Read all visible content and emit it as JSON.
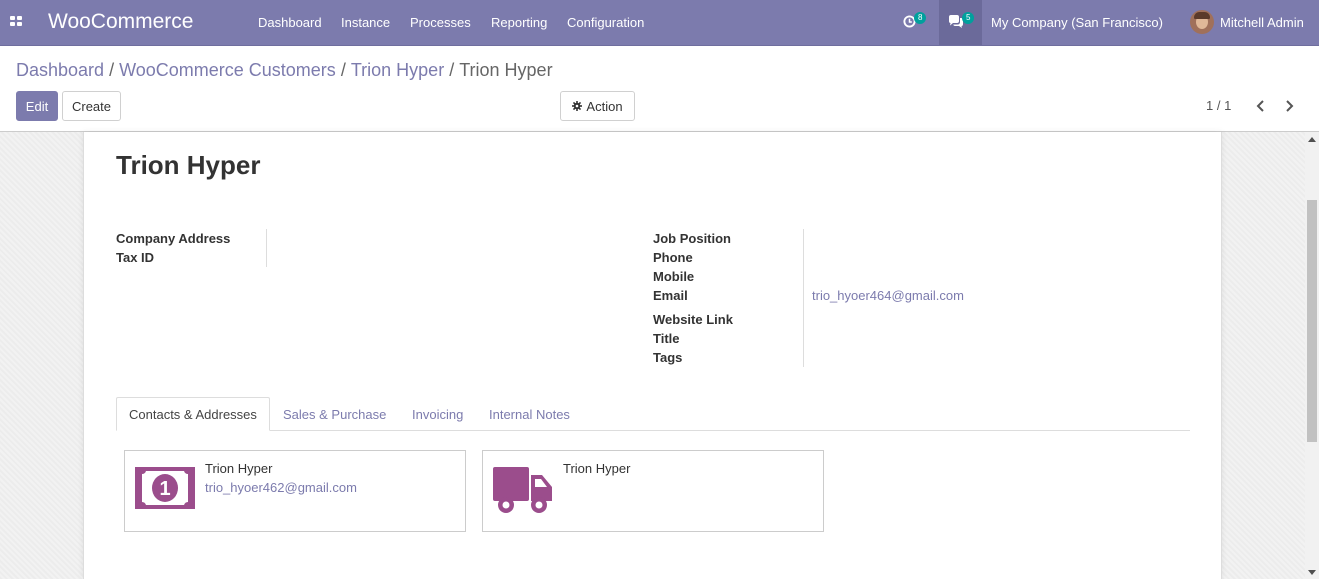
{
  "navbar": {
    "brand": "WooCommerce",
    "menu": [
      "Dashboard",
      "Instance",
      "Processes",
      "Reporting",
      "Configuration"
    ],
    "activity_count": "8",
    "messages_count": "5",
    "company": "My Company (San Francisco)",
    "user": "Mitchell Admin"
  },
  "breadcrumb": {
    "items": [
      "Dashboard",
      "WooCommerce Customers",
      "Trion Hyper"
    ],
    "current": "Trion Hyper",
    "separator": "/"
  },
  "actions": {
    "edit_label": "Edit",
    "create_label": "Create",
    "action_label": "Action"
  },
  "pager": {
    "value": "1 / 1"
  },
  "record": {
    "name": "Trion Hyper",
    "left_fields": [
      "Company Address",
      "Tax ID"
    ],
    "right_fields": {
      "job_position": "Job Position",
      "phone": "Phone",
      "mobile": "Mobile",
      "email_label": "Email",
      "email_value": "trio_hyoer464@gmail.com",
      "website": "Website Link",
      "title": "Title",
      "tags": "Tags"
    }
  },
  "tabs": [
    "Contacts & Addresses",
    "Sales & Purchase",
    "Invoicing",
    "Internal Notes"
  ],
  "cards": [
    {
      "name": "Trion Hyper",
      "email": "trio_hyoer462@gmail.com",
      "icon": "invoice-money-icon"
    },
    {
      "name": "Trion Hyper",
      "icon": "delivery-truck-icon"
    }
  ],
  "colors": {
    "navbar": "#7c7bad",
    "link": "#7c7bad",
    "badge": "#00a09d",
    "card_icon": "#9b4d8c"
  }
}
